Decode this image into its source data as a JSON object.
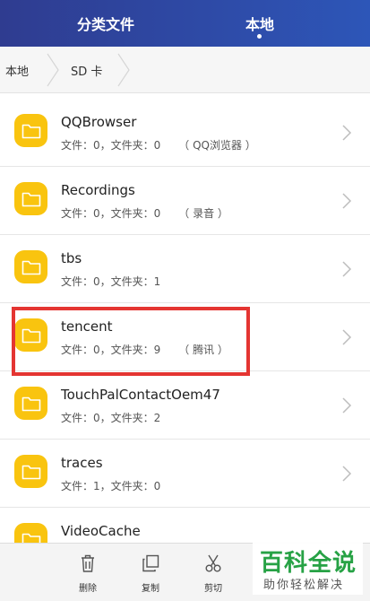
{
  "header": {
    "tabs": [
      {
        "label": "分类文件",
        "active": false
      },
      {
        "label": "本地",
        "active": true
      }
    ]
  },
  "breadcrumb": [
    "本地",
    "SD 卡"
  ],
  "folders": [
    {
      "name": "QQBrowser",
      "info": "文件：0，文件夹：0",
      "tag": "（ QQ浏览器 ）"
    },
    {
      "name": "Recordings",
      "info": "文件：0，文件夹：0",
      "tag": "（ 录音 ）"
    },
    {
      "name": "tbs",
      "info": "文件：0，文件夹：1",
      "tag": ""
    },
    {
      "name": "tencent",
      "info": "文件：0，文件夹：9",
      "tag": "（ 腾讯 ）"
    },
    {
      "name": "TouchPalContactOem47",
      "info": "文件：0，文件夹：2",
      "tag": ""
    },
    {
      "name": "traces",
      "info": "文件：1，文件夹：0",
      "tag": ""
    },
    {
      "name": "VideoCache",
      "info": "",
      "tag": ""
    }
  ],
  "bottom_actions": [
    {
      "label": "删除",
      "icon": "trash-icon"
    },
    {
      "label": "复制",
      "icon": "copy-icon"
    },
    {
      "label": "剪切",
      "icon": "scissors-icon"
    }
  ],
  "watermark": {
    "title": "百科全说",
    "subtitle": "助你轻松解决"
  },
  "colors": {
    "header": "#2e4aa6",
    "folder": "#f9c40f",
    "highlight": "#e43532",
    "watermark": "#27a245"
  }
}
